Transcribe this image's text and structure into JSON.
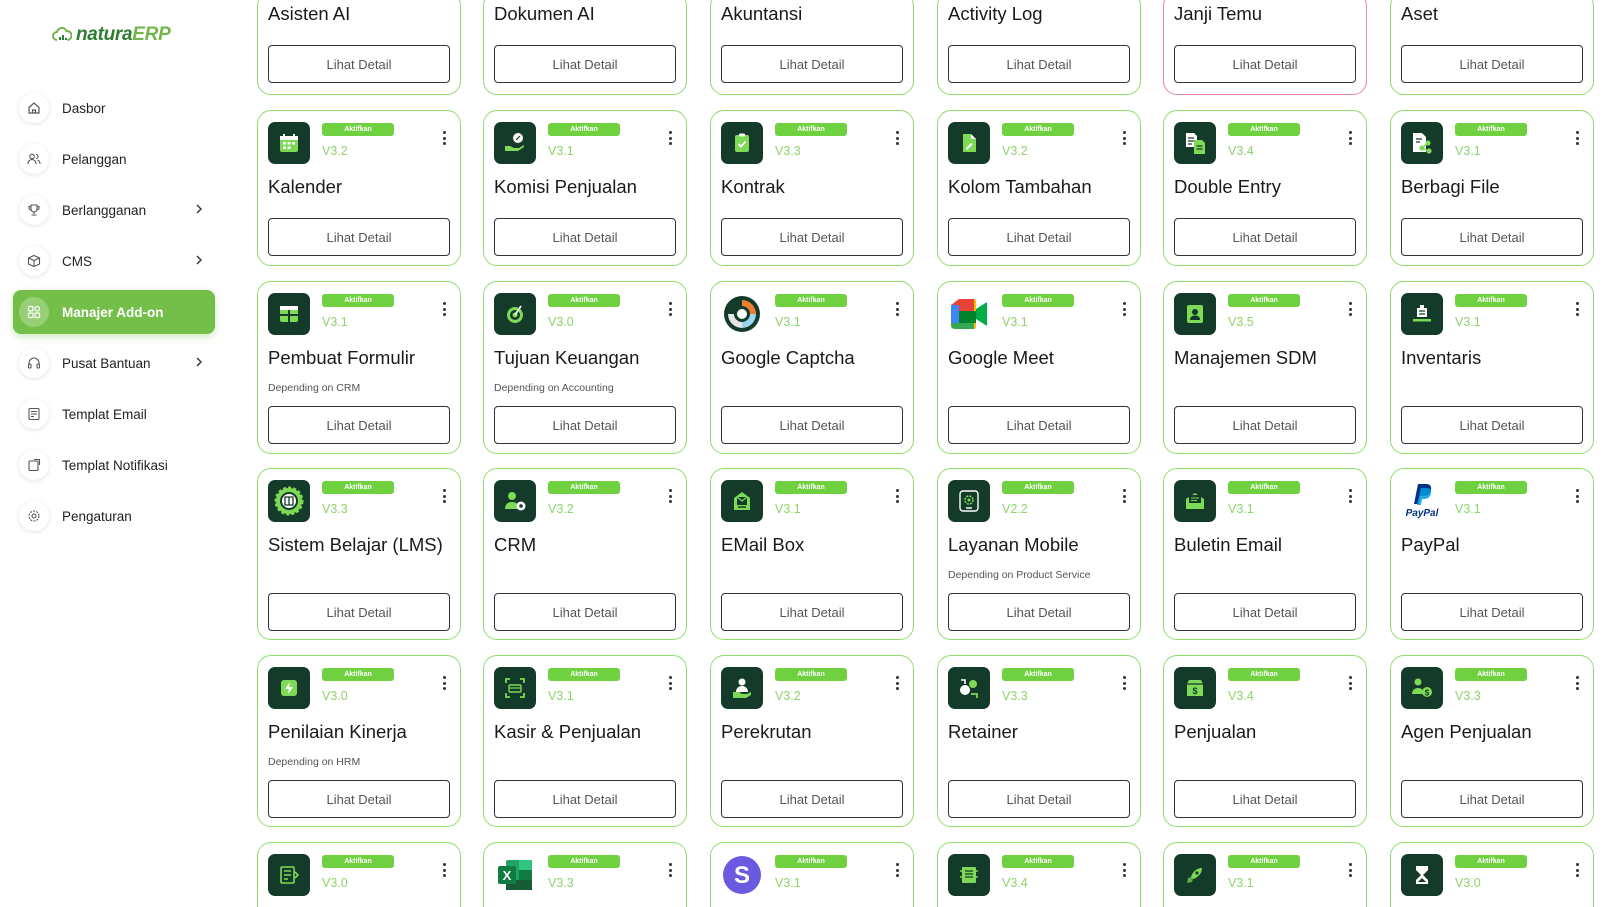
{
  "brand": {
    "name_part1": "natura",
    "name_part2": "ERP"
  },
  "sidebar": {
    "items": [
      {
        "label": "Dasbor",
        "icon": "home-icon"
      },
      {
        "label": "Pelanggan",
        "icon": "users-icon"
      },
      {
        "label": "Berlangganan",
        "icon": "trophy-icon",
        "has_submenu": true
      },
      {
        "label": "CMS",
        "icon": "box-icon",
        "has_submenu": true
      },
      {
        "label": "Manajer Add-on",
        "icon": "grid-icon",
        "active": true
      },
      {
        "label": "Pusat Bantuan",
        "icon": "headset-icon",
        "has_submenu": true
      },
      {
        "label": "Templat Email",
        "icon": "template-icon"
      },
      {
        "label": "Templat Notifikasi",
        "icon": "notification-template-icon"
      },
      {
        "label": "Pengaturan",
        "icon": "gear-icon"
      }
    ]
  },
  "addons": {
    "badge_label": "Aktifkan",
    "button_label": "Lihat Detail",
    "row0": [
      {
        "title": "Asisten AI"
      },
      {
        "title": "Dokumen AI"
      },
      {
        "title": "Akuntansi"
      },
      {
        "title": "Activity Log"
      },
      {
        "title": "Janji Temu"
      },
      {
        "title": "Aset"
      }
    ],
    "row1": [
      {
        "title": "Kalender",
        "version": "V3.2",
        "icon": "calendar-icon"
      },
      {
        "title": "Komisi Penjualan",
        "version": "V3.1",
        "icon": "commission-icon"
      },
      {
        "title": "Kontrak",
        "version": "V3.3",
        "icon": "contract-icon"
      },
      {
        "title": "Kolom Tambahan",
        "version": "V3.2",
        "icon": "custom-field-icon"
      },
      {
        "title": "Double Entry",
        "version": "V3.4",
        "icon": "double-entry-icon"
      },
      {
        "title": "Berbagi File",
        "version": "V3.1",
        "icon": "file-share-icon"
      }
    ],
    "row2": [
      {
        "title": "Pembuat Formulir",
        "version": "V3.1",
        "icon": "form-builder-icon",
        "depends": "Depending on CRM"
      },
      {
        "title": "Tujuan Keuangan",
        "version": "V3.0",
        "icon": "finance-goal-icon",
        "depends": "Depending on Accounting"
      },
      {
        "title": "Google Captcha",
        "version": "V3.1",
        "icon": "captcha-icon",
        "depends": ""
      },
      {
        "title": "Google Meet",
        "version": "V3.1",
        "icon": "google-meet-icon",
        "depends": ""
      },
      {
        "title": "Manajemen SDM",
        "version": "V3.5",
        "icon": "hrm-icon",
        "depends": ""
      },
      {
        "title": "Inventaris",
        "version": "V3.1",
        "icon": "inventory-icon",
        "depends": ""
      }
    ],
    "row3": [
      {
        "title": "Sistem Belajar (LMS)",
        "version": "V3.3",
        "icon": "lms-icon",
        "depends": ""
      },
      {
        "title": "CRM",
        "version": "V3.2",
        "icon": "crm-icon",
        "depends": ""
      },
      {
        "title": "EMail Box",
        "version": "V3.1",
        "icon": "mailbox-icon",
        "depends": ""
      },
      {
        "title": "Layanan Mobile",
        "version": "V2.2",
        "icon": "mobile-service-icon",
        "depends": "Depending on Product Service"
      },
      {
        "title": "Buletin Email",
        "version": "V3.1",
        "icon": "newsletter-icon",
        "depends": ""
      },
      {
        "title": "PayPal",
        "version": "V3.1",
        "icon": "paypal-icon",
        "depends": "",
        "logo_text": "PayPal"
      }
    ],
    "row4": [
      {
        "title": "Penilaian Kinerja",
        "version": "V3.0",
        "icon": "performance-icon",
        "depends": "Depending on HRM"
      },
      {
        "title": "Kasir & Penjualan",
        "version": "V3.1",
        "icon": "pos-icon",
        "depends": ""
      },
      {
        "title": "Perekrutan",
        "version": "V3.2",
        "icon": "recruitment-icon",
        "depends": ""
      },
      {
        "title": "Retainer",
        "version": "V3.3",
        "icon": "retainer-icon",
        "depends": ""
      },
      {
        "title": "Penjualan",
        "version": "V3.4",
        "icon": "sales-icon",
        "depends": ""
      },
      {
        "title": "Agen Penjualan",
        "version": "V3.3",
        "icon": "sales-agent-icon",
        "depends": ""
      }
    ],
    "row5": [
      {
        "version": "V3.0",
        "icon": "addon-icon"
      },
      {
        "version": "V3.3",
        "icon": "excel-icon"
      },
      {
        "version": "V3.1",
        "icon": "s-logo-icon"
      },
      {
        "version": "V3.4",
        "icon": "addon-icon"
      },
      {
        "version": "V3.1",
        "icon": "rocket-icon"
      },
      {
        "version": "V3.0",
        "icon": "hourglass-icon"
      }
    ]
  },
  "colors": {
    "accent": "#74bf4a",
    "badge": "#6fd13f",
    "card_border": "#8ee06a",
    "icon_bg": "#143a2a",
    "highlight_border": "#e8879e"
  }
}
